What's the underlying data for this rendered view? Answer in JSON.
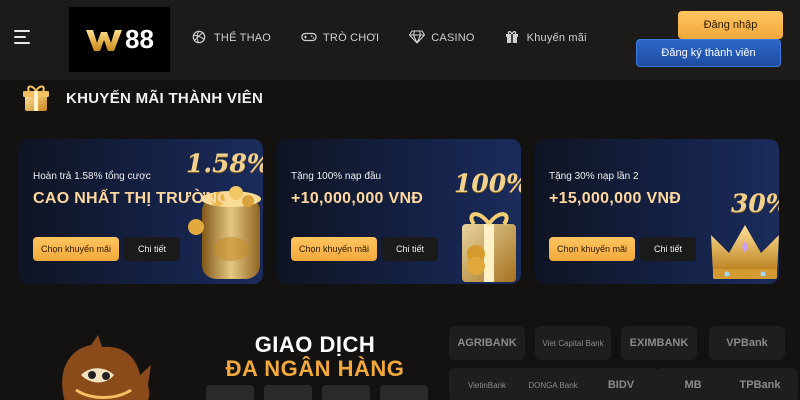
{
  "header": {
    "logo_text": "88",
    "nav": [
      {
        "label": "THỂ THAO",
        "icon": "volleyball-icon"
      },
      {
        "label": "TRÒ CHƠI",
        "icon": "gamepad-icon"
      },
      {
        "label": "CASINO",
        "icon": "diamond-icon"
      },
      {
        "label": "Khuyến mãi",
        "icon": "gift-icon"
      }
    ],
    "login_label": "Đăng nhập",
    "register_label": "Đăng ký thành viên"
  },
  "section": {
    "title": "KHUYẾN MÃI THÀNH VIÊN",
    "icon": "gift-box-icon"
  },
  "promos": [
    {
      "subtitle": "Hoàn trả 1.58% tổng cược",
      "headline": "CAO NHẤT THỊ TRƯỜNG",
      "badge": "1.58%",
      "choose_label": "Chọn khuyến mãi",
      "detail_label": "Chi tiết",
      "art": "gold-coin-jar"
    },
    {
      "subtitle": "Tặng 100% nạp đầu",
      "headline": "+10,000,000 VNĐ",
      "badge": "100%",
      "choose_label": "Chọn khuyến mãi",
      "detail_label": "Chi tiết",
      "art": "gift-box-coins"
    },
    {
      "subtitle": "Tặng 30% nạp lần 2",
      "headline": "+15,000,000 VNĐ",
      "badge": "30%",
      "choose_label": "Chọn khuyến mãi",
      "detail_label": "Chi tiết",
      "art": "gold-crown"
    }
  ],
  "transactions": {
    "title_line1": "GIAO DỊCH",
    "title_line2": "ĐA NGÂN HÀNG",
    "banks": [
      "AGRIBANK",
      "Viet Capital Bank",
      "EXIMBANK",
      "VPBank",
      "VietinBank",
      "DONGA Bank",
      "BIDV",
      "MB",
      "TPBank"
    ]
  },
  "colors": {
    "accent_gold": "#f2a93b",
    "brand_blue": "#1e4da2",
    "background": "#141211"
  }
}
